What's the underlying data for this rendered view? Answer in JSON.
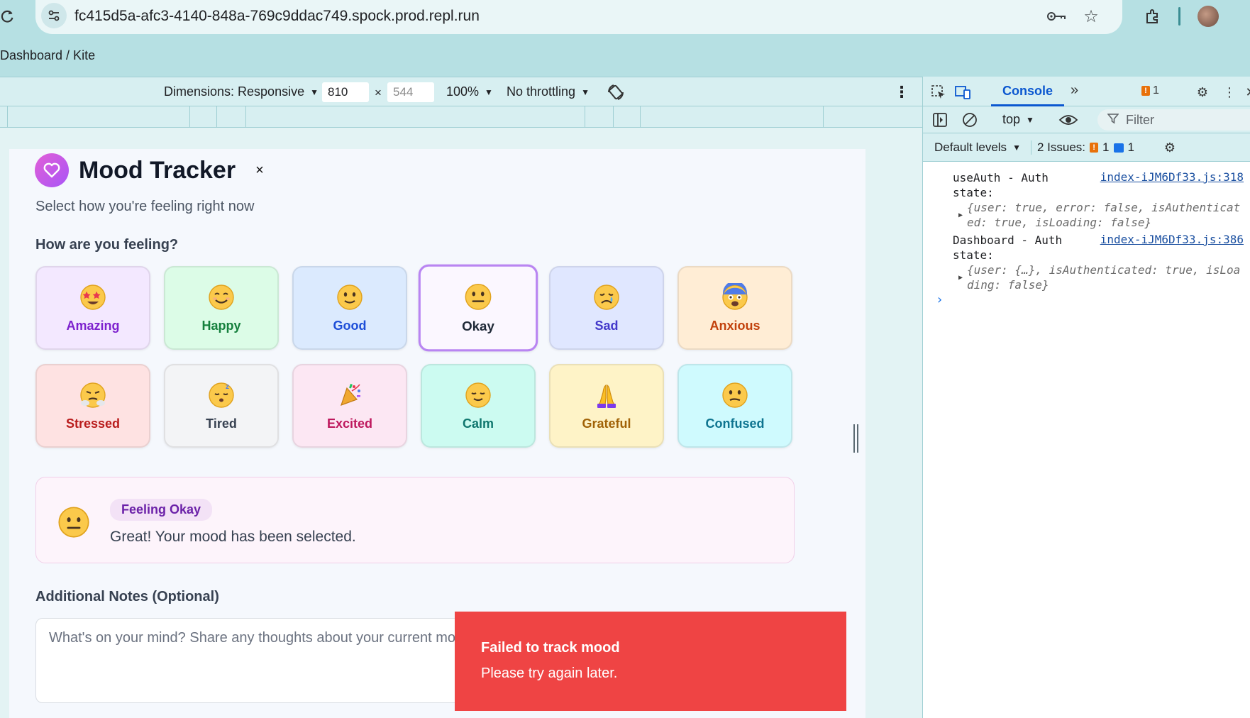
{
  "browser": {
    "url": "fc415d5a-afc3-4140-848a-769c9ddac749.spock.prod.repl.run",
    "breadcrumb": "Dashboard / Kite"
  },
  "device_toolbar": {
    "dimensions_label": "Dimensions: Responsive",
    "width": "810",
    "height_placeholder": "544",
    "times": "×",
    "zoom": "100%",
    "throttling": "No throttling"
  },
  "app": {
    "title": "Mood Tracker",
    "close": "×",
    "subtitle": "Select how you're feeling right now",
    "question": "How are you feeling?",
    "moods": [
      {
        "label": "Amazing",
        "color": "#7e22ce",
        "bg": "#f3e8ff",
        "icon": "star-struck-emoji",
        "selected": false
      },
      {
        "label": "Happy",
        "color": "#15803d",
        "bg": "#dcfce7",
        "icon": "smiling-emoji",
        "selected": false
      },
      {
        "label": "Good",
        "color": "#1d4ed8",
        "bg": "#dbeafe",
        "icon": "slightly-smiling-emoji",
        "selected": false
      },
      {
        "label": "Okay",
        "color": "#1f2937",
        "bg": "#fbf7ff",
        "icon": "neutral-face-emoji",
        "selected": true
      },
      {
        "label": "Sad",
        "color": "#4338ca",
        "bg": "#e0e7ff",
        "icon": "crying-face-emoji",
        "selected": false
      },
      {
        "label": "Anxious",
        "color": "#c2410c",
        "bg": "#ffedd5",
        "icon": "fearful-face-emoji",
        "selected": false
      },
      {
        "label": "Stressed",
        "color": "#b91c1c",
        "bg": "#fee2e2",
        "icon": "steam-face-emoji",
        "selected": false
      },
      {
        "label": "Tired",
        "color": "#374151",
        "bg": "#f3f4f6",
        "icon": "sleeping-face-emoji",
        "selected": false
      },
      {
        "label": "Excited",
        "color": "#be185d",
        "bg": "#fce7f3",
        "icon": "party-popper-emoji",
        "selected": false
      },
      {
        "label": "Calm",
        "color": "#0f766e",
        "bg": "#ccfbf1",
        "icon": "relieved-face-emoji",
        "selected": false
      },
      {
        "label": "Grateful",
        "color": "#a16207",
        "bg": "#fef3c7",
        "icon": "folded-hands-emoji",
        "selected": false
      },
      {
        "label": "Confused",
        "color": "#0e7490",
        "bg": "#cffafe",
        "icon": "confused-face-emoji",
        "selected": false
      }
    ],
    "status": {
      "badge": "Feeling Okay",
      "message": "Great! Your mood has been selected."
    },
    "notes": {
      "label": "Additional Notes (Optional)",
      "placeholder": "What's on your mind? Share any thoughts about your current mood...",
      "value": ""
    },
    "toast": {
      "title": "Failed to track mood",
      "description": "Please try again later.",
      "color": "#ef4444"
    }
  },
  "devtools": {
    "active_tab": "Console",
    "more_tabs": "»",
    "issues_badge": "1",
    "context": "top",
    "filter_placeholder": "Filter",
    "levels": "Default levels",
    "issues_label": "2 Issues:",
    "issues_warn": "1",
    "issues_info": "1",
    "logs": [
      {
        "message": "useAuth - Auth\nstate:",
        "source": "index-iJM6Df33.js:318",
        "object": "{user: true, error: false, isAuthenticated: true, isLoading: false}"
      },
      {
        "message": "Dashboard - Auth\nstate:",
        "source": "index-iJM6Df33.js:386",
        "object": "{user: {…}, isAuthenticated: true, isLoading: false}"
      }
    ],
    "prompt": "›"
  }
}
